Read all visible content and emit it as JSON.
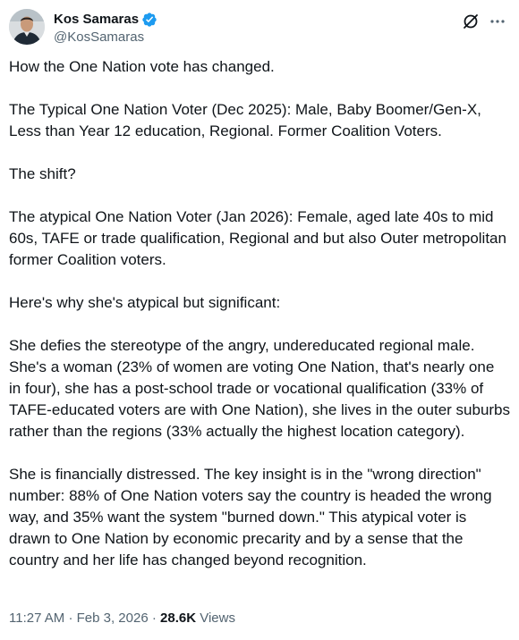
{
  "author": {
    "display_name": "Kos Samaras",
    "handle": "@KosSamaras",
    "verified_color": "#1d9bf0"
  },
  "icons": {
    "verified": "verified-badge-icon",
    "grok": "grok-icon",
    "more": "more-icon"
  },
  "tweet": {
    "paragraphs": [
      "How the One Nation vote has changed.",
      "The Typical One Nation Voter (Dec 2025): Male, Baby Boomer/Gen-X, Less than Year 12 education, Regional.  Former Coalition Voters.",
      "The shift?",
      "The atypical One Nation Voter (Jan 2026): Female, aged late 40s to mid 60s, TAFE or trade qualification, Regional and but also Outer metropolitan former Coalition voters.",
      "Here's why she's atypical but significant:",
      "She defies the stereotype of the angry, undereducated regional male. She's a woman (23% of women are voting One Nation, that's nearly one in four), she has a post-school trade or vocational qualification (33% of TAFE-educated voters are with One Nation), she lives in the outer suburbs rather than the regions (33% actually the highest location category).",
      "She is financially distressed.  The key insight is in the \"wrong direction\" number: 88% of One Nation voters say the country is headed the wrong way, and 35% want the system \"burned down.\" This atypical voter is drawn to One Nation by economic precarity and by a sense that the country and her life has changed beyond recognition."
    ],
    "time": "11:27 AM",
    "separator": "·",
    "date": "Feb 3, 2026",
    "views_count": "28.6K",
    "views_label": "Views"
  }
}
